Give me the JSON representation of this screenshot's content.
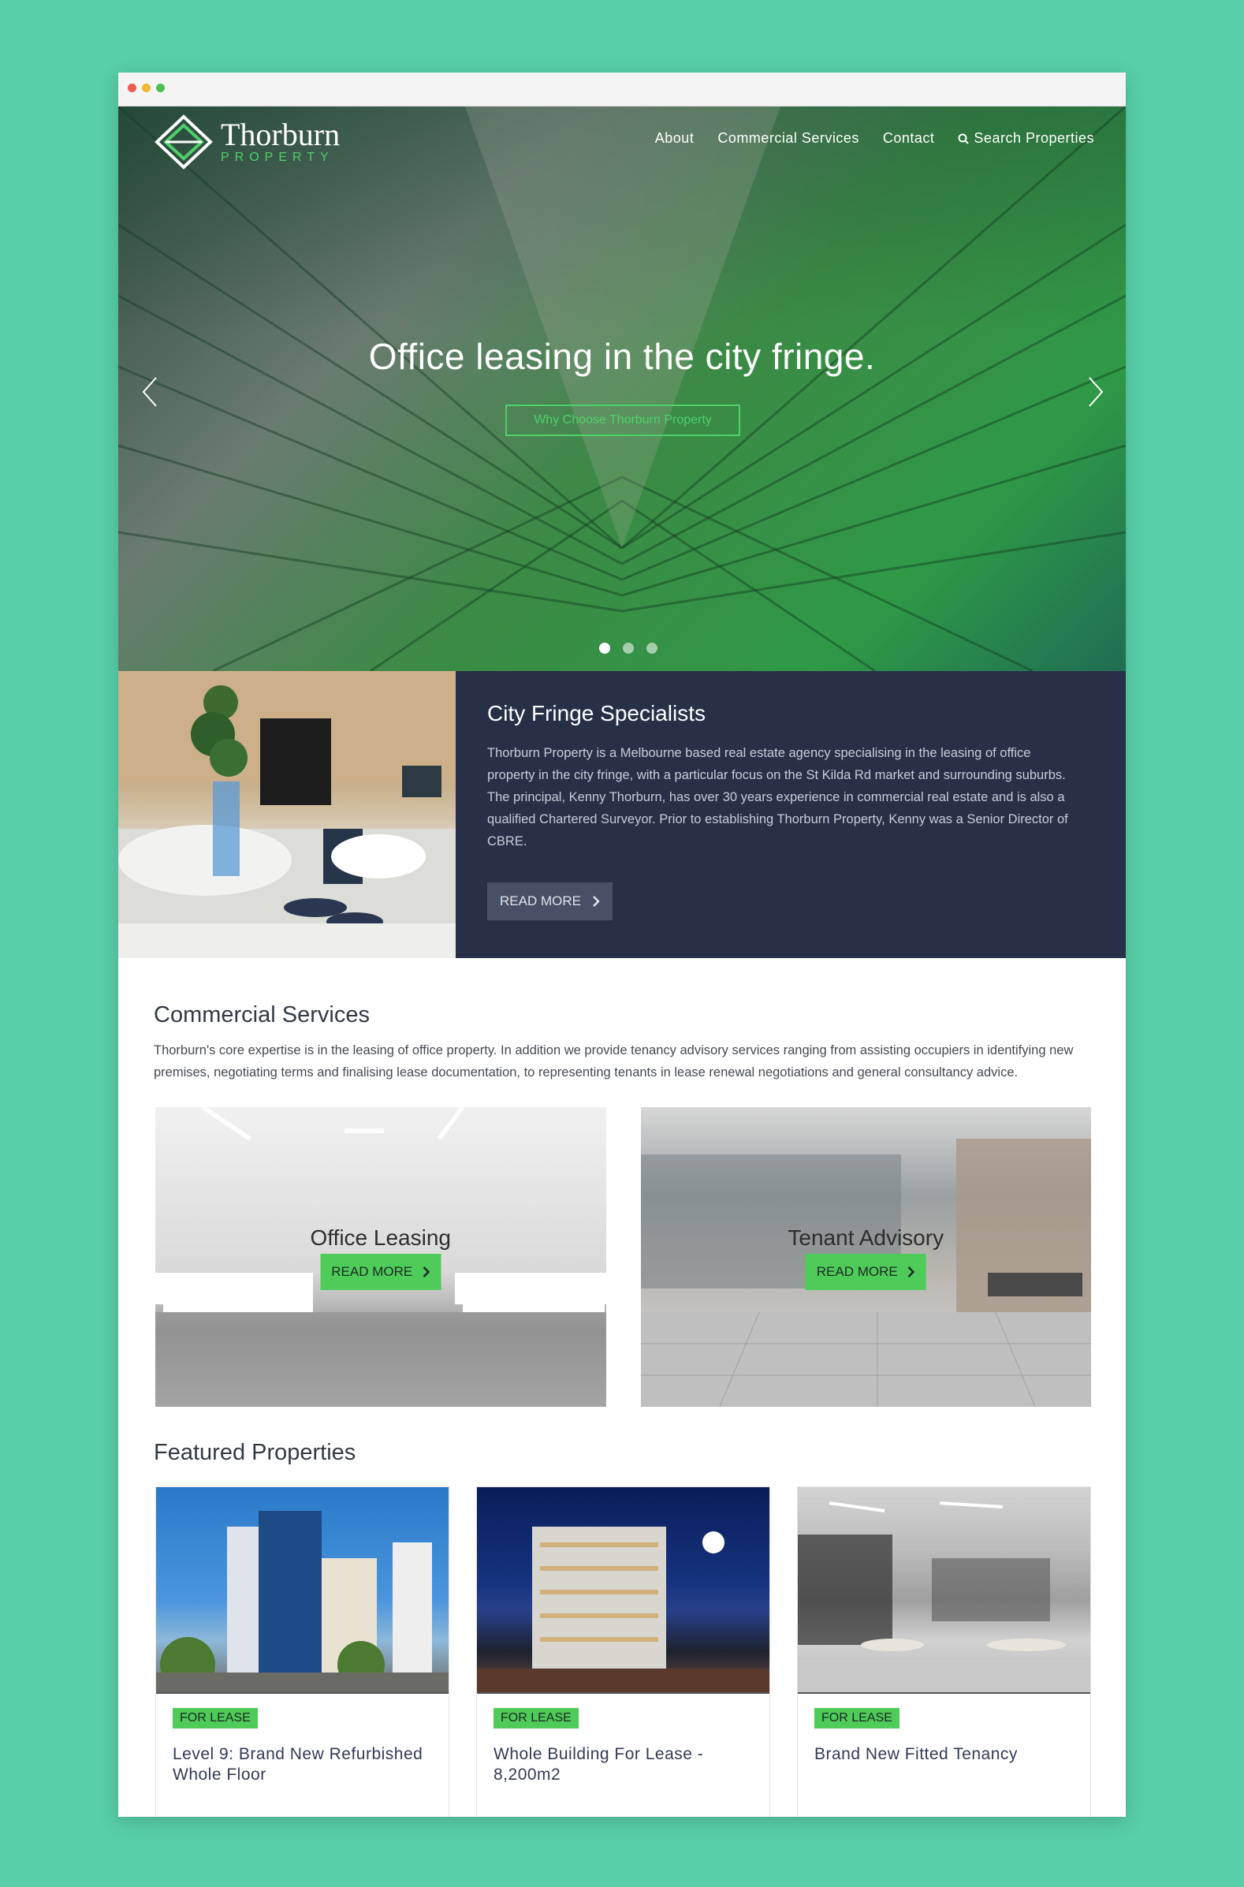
{
  "colors": {
    "background": "#58cfa9",
    "accent": "#4fcb5a",
    "panel": "#283048"
  },
  "brand": {
    "name": "Thorburn",
    "sub": "PROPERTY"
  },
  "nav": {
    "items": [
      "About",
      "Commercial Services",
      "Contact"
    ],
    "search_label": "Search Properties"
  },
  "hero": {
    "title": "Office leasing in the city fringe.",
    "button": "Why Choose Thorburn Property",
    "slides": 3,
    "active_slide": 1
  },
  "about": {
    "title": "City Fringe Specialists",
    "text": "Thorburn Property is a Melbourne based real estate agency specialising in the leasing of office property in the city fringe, with a particular focus on the St Kilda Rd market and surrounding suburbs. The principal, Kenny Thorburn, has over 30 years experience in commercial real estate and is also a qualified Chartered Surveyor. Prior to establishing Thorburn Property, Kenny was a Senior Director of CBRE.",
    "button": "READ MORE"
  },
  "services": {
    "title": "Commercial Services",
    "text": "Thorburn's core expertise is in the leasing of office property. In addition we provide tenancy advisory services ranging from assisting occupiers in identifying new premises, negotiating terms and finalising lease documentation, to representing tenants in lease renewal negotiations and general consultancy advice.",
    "cards": [
      {
        "label": "Office Leasing",
        "button": "READ MORE"
      },
      {
        "label": "Tenant Advisory",
        "button": "READ MORE"
      }
    ]
  },
  "featured": {
    "title": "Featured Properties",
    "items": [
      {
        "badge": "FOR LEASE",
        "title": "Level 9: Brand New Refurbished Whole Floor"
      },
      {
        "badge": "FOR LEASE",
        "title": "Whole Building For Lease - 8,200m2"
      },
      {
        "badge": "FOR LEASE",
        "title": "Brand New Fitted Tenancy"
      }
    ]
  }
}
